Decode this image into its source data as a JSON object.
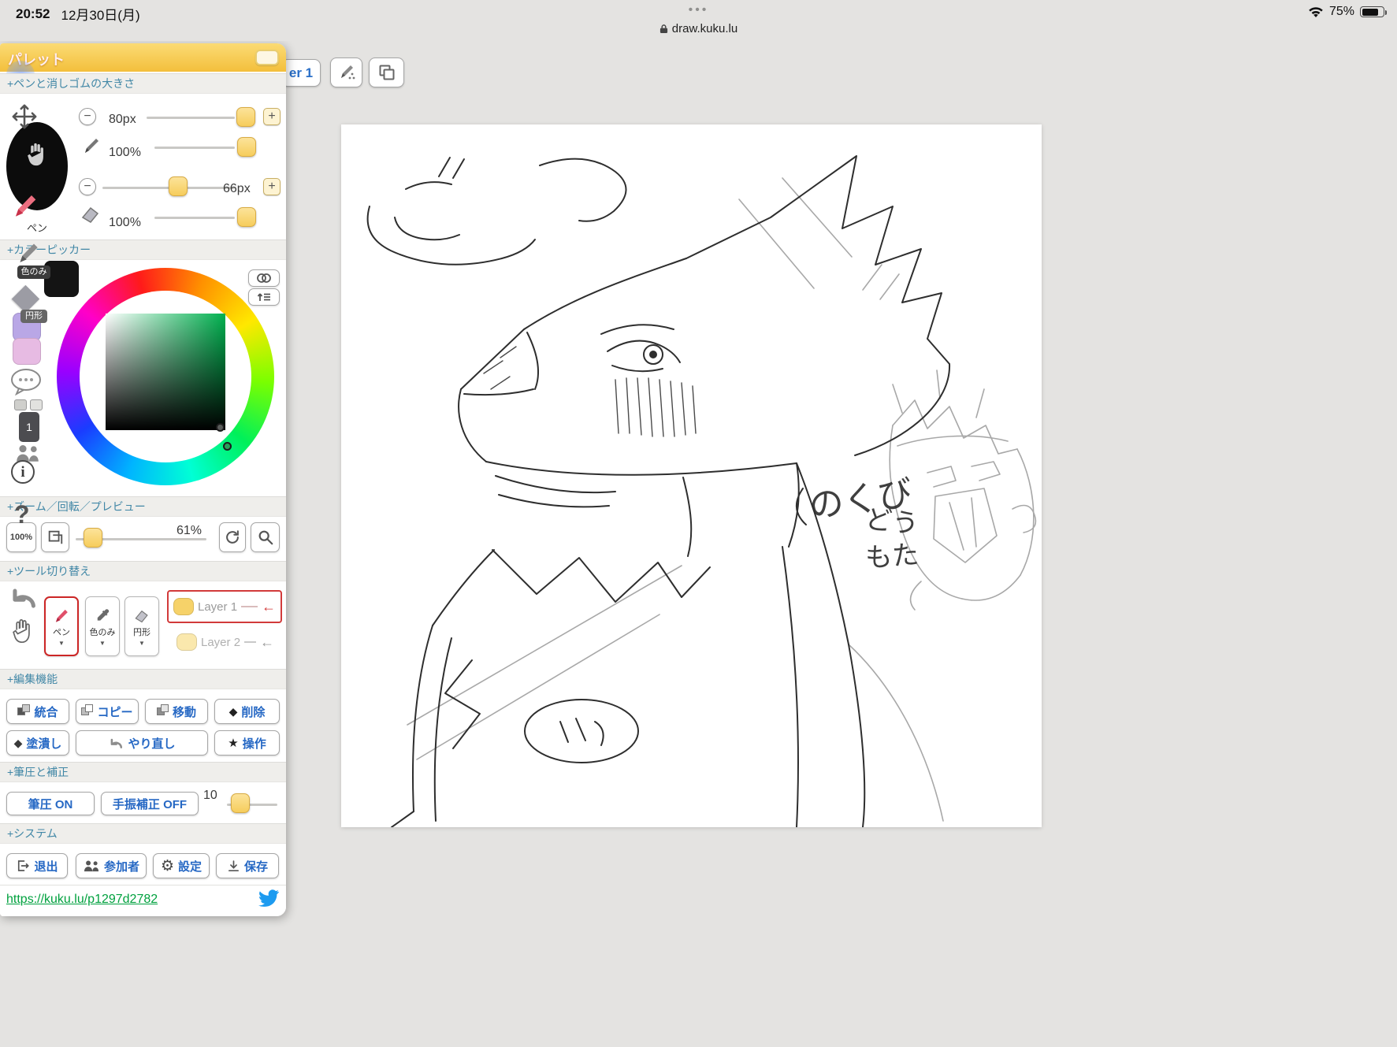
{
  "status_bar": {
    "time": "20:52",
    "date": "12月30日(月)",
    "handle_dots": "•••",
    "site": "draw.kuku.lu",
    "battery": "75%"
  },
  "top_toolbar": {
    "layer_button": "er 1"
  },
  "palette": {
    "title": "パレット",
    "pen_section": {
      "label": "+ペンと消しゴムの大きさ",
      "pen_size": "80px",
      "pen_opacity": "100%",
      "eraser_size": "66px",
      "eraser_opacity": "100%",
      "minus": "−",
      "plus": "+"
    },
    "side_strip": {
      "pen_label": "ペン",
      "color_only_label": "色のみ",
      "circle_label": "円形",
      "info": "i",
      "help": "?",
      "layer_badge": "1"
    },
    "color_section": {
      "label": "+カラーピッカー"
    },
    "zoom_section": {
      "label": "+ズーム／回転／プレビュー",
      "reset": "100%",
      "value": "61%"
    },
    "tool_section": {
      "label": "+ツール切り替え",
      "pen": "ペン",
      "color_only": "色のみ",
      "circle": "円形",
      "caret": "▼",
      "layers": [
        {
          "name": "Layer 1",
          "arrow": "←"
        },
        {
          "name": "Layer 2",
          "arrow": "←"
        }
      ]
    },
    "edit_section": {
      "label": "+編集機能",
      "buttons_row1": [
        "統合",
        "コピー",
        "移動",
        "削除"
      ],
      "buttons_row2": [
        "塗潰し",
        "やり直し",
        "操作"
      ]
    },
    "pressure_section": {
      "label": "+筆圧と補正",
      "pressure_btn": "筆圧 ON",
      "stabilizer_btn": "手振補正 OFF",
      "value": "10"
    },
    "system_section": {
      "label": "+システム",
      "buttons": [
        "退出",
        "参加者",
        "設定",
        "保存"
      ]
    },
    "footer": {
      "link": "https://kuku.lu/p1297d2782"
    }
  },
  "canvas": {
    "scribbles": [
      "のくび",
      "どう",
      "もた"
    ]
  }
}
